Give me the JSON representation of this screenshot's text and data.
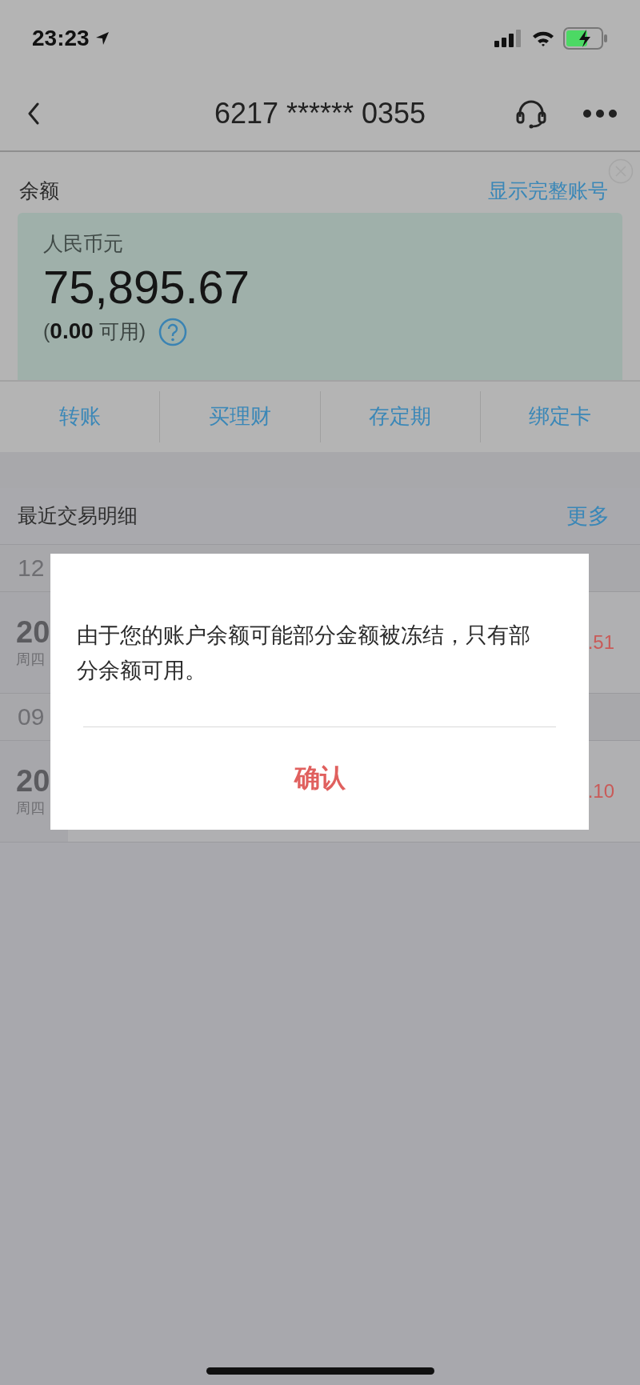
{
  "status_bar": {
    "time": "23:23"
  },
  "nav": {
    "title": "6217 ****** 0355"
  },
  "balance": {
    "label": "余额",
    "link": "显示完整账号",
    "currency": "人民币元",
    "amount": "75,895.67",
    "available": "(**0.00** 可用)"
  },
  "actions": [
    "转账",
    "买理财",
    "存定期",
    "绑定卡"
  ],
  "transactions": {
    "title": "最近交易明细",
    "more": "更多",
    "groups": [
      {
        "month": "12",
        "rows": [
          {
            "date": "20",
            "weekday": "周四",
            "amount": ".51"
          }
        ]
      },
      {
        "month": "09",
        "rows": [
          {
            "date": "20",
            "weekday": "周四",
            "amount": ".10"
          }
        ]
      }
    ]
  },
  "dialog": {
    "message": "由于您的账户余额可能部分金额被冻结，只有部分余额可用。",
    "button": "确认"
  }
}
